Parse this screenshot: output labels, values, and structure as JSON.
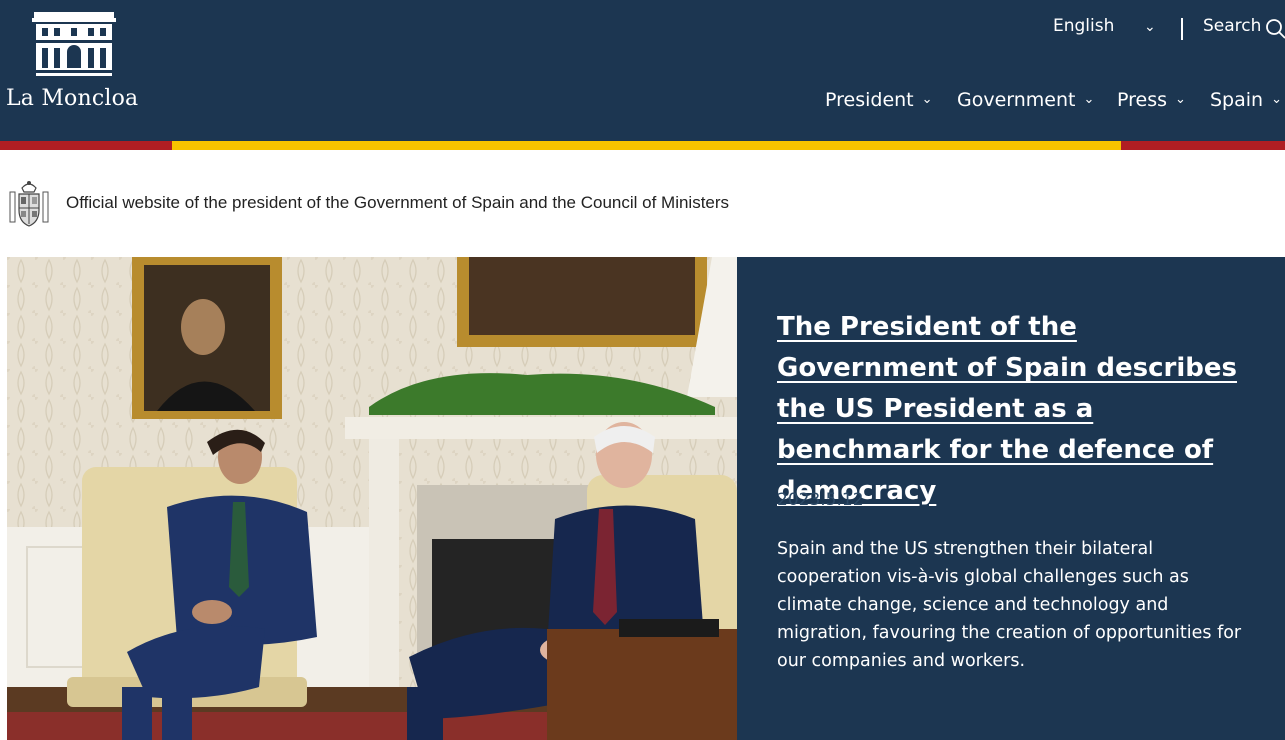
{
  "header": {
    "site_name": "La Moncloa",
    "language": "English",
    "search_label": "Search",
    "nav": [
      {
        "label": "President"
      },
      {
        "label": "Government"
      },
      {
        "label": "Press"
      },
      {
        "label": "Spain"
      }
    ]
  },
  "colors": {
    "header_bg": "#1c3651",
    "flag_red": "#b01e23",
    "flag_yellow": "#f7c300"
  },
  "official_banner": "Official website of the president of the Government of Spain and the Council of Ministers",
  "feature": {
    "headline": "The President of the Government of Spain describes the US President as a benchmark for the defence of democracy",
    "date": "2023.5.12",
    "summary": "Spain and the US strengthen their bilateral cooperation vis-à-vis global challenges such as climate change, science and technology and migration, favouring the creation of opportunities for our companies and workers."
  }
}
